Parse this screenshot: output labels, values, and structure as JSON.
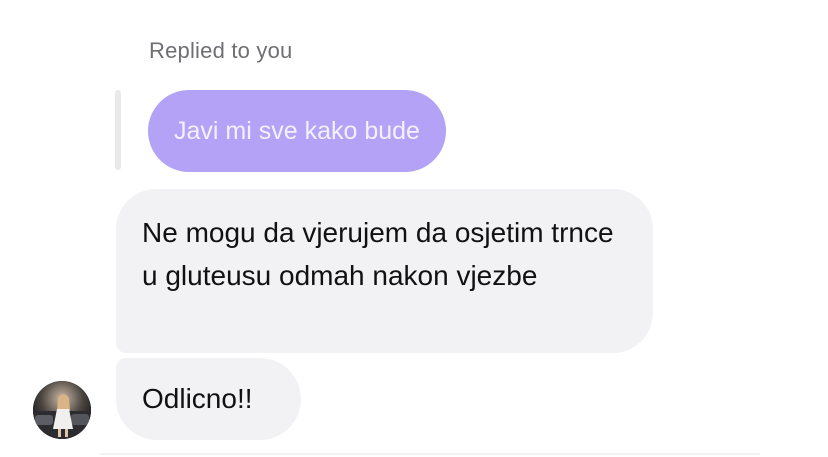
{
  "reply_header": {
    "label": "Replied to you"
  },
  "quoted_message": {
    "text": "Javi mi sve kako bude",
    "color": "#b3a2f6"
  },
  "messages": [
    {
      "text": "Ne mogu da vjerujem da osjetim trnce u gluteusu odmah nakon vjezbe"
    },
    {
      "text": "Odlicno!!"
    }
  ],
  "sender": {
    "avatar_icon": "user-photo-avatar"
  },
  "colors": {
    "incoming_bubble": "#f2f2f5",
    "meta_text": "#6e6e73"
  }
}
